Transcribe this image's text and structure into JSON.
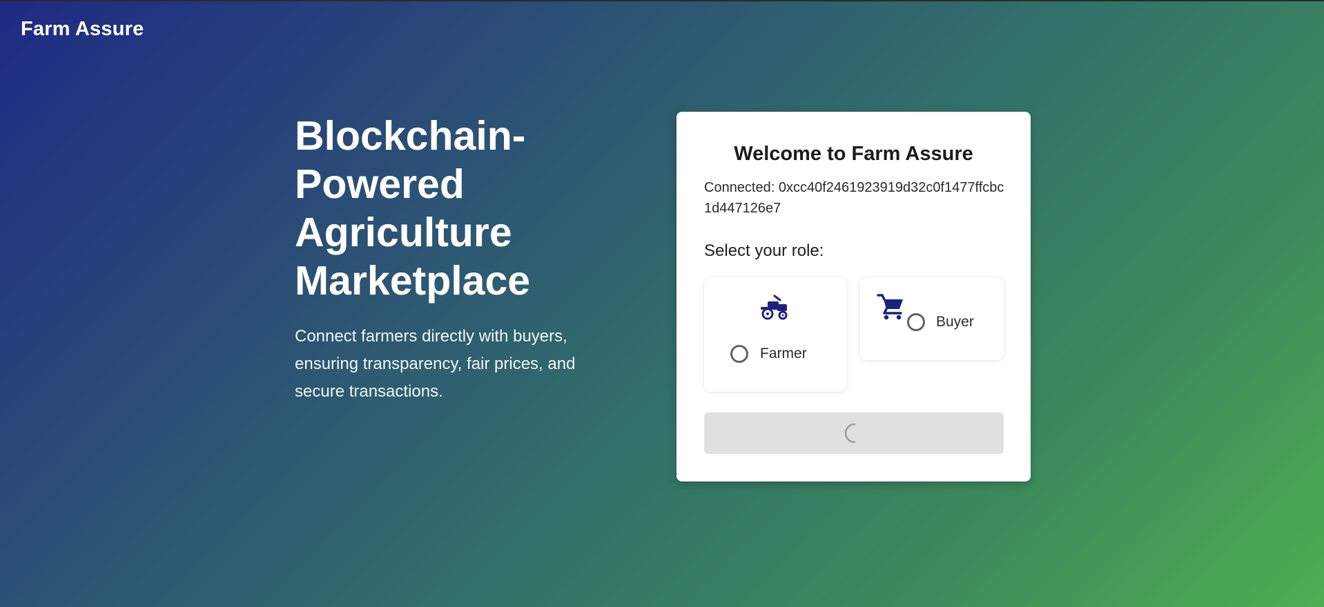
{
  "header": {
    "brand": "Farm Assure"
  },
  "hero": {
    "title": "Blockchain-Powered Agriculture Marketplace",
    "subtitle": "Connect farmers directly with buyers, ensuring transparency, fair prices, and secure transactions."
  },
  "card": {
    "title": "Welcome to Farm Assure",
    "connected_label": "Connected: 0xcc40f2461923919d32c0f1477ffcbc1d447126e7",
    "role_prompt": "Select your role:",
    "roles": [
      {
        "label": "Farmer",
        "icon": "tractor-icon",
        "selected": false
      },
      {
        "label": "Buyer",
        "icon": "shopping-cart-icon",
        "selected": false
      }
    ],
    "submit": {
      "state": "loading"
    }
  },
  "colors": {
    "gradient_start": "#1e2a84",
    "gradient_end": "#4caf50",
    "icon_color": "#1a237e",
    "button_disabled": "#e0e0e0"
  }
}
